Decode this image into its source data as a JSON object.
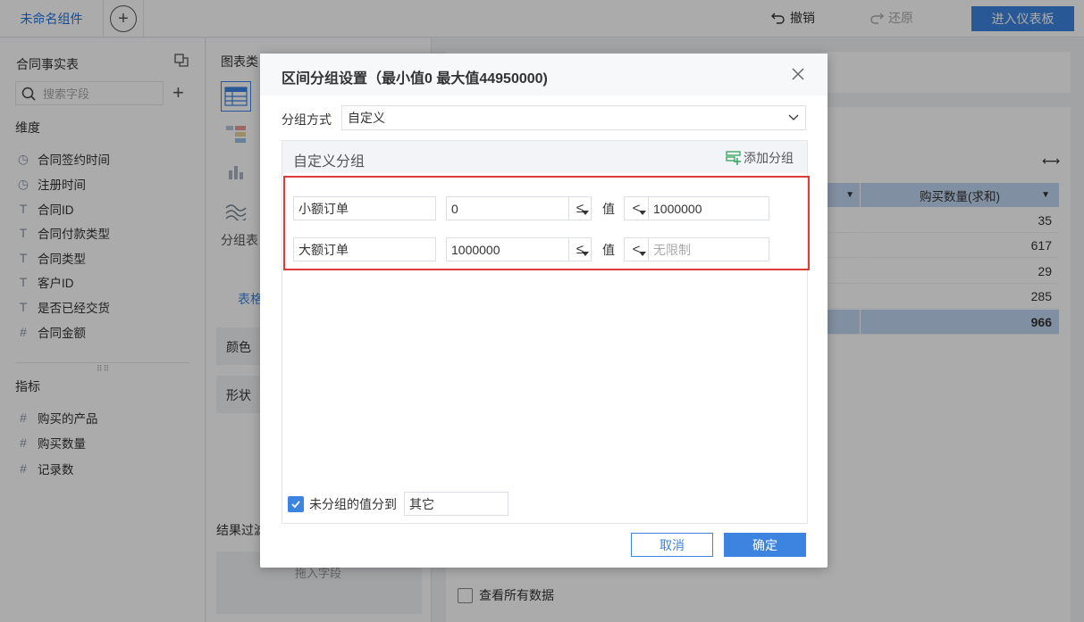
{
  "topbar": {
    "tab_name": "未命名组件",
    "undo_label": "撤销",
    "redo_label": "还原",
    "enter_dashboard_label": "进入仪表板"
  },
  "field_panel": {
    "dataset_title": "合同事实表",
    "search_placeholder": "搜索字段",
    "dimension_title": "维度",
    "dimensions": [
      {
        "icon": "clock-icon",
        "label": "合同签约时间"
      },
      {
        "icon": "clock-icon",
        "label": "注册时间"
      },
      {
        "icon": "text-type-icon",
        "label": "合同ID"
      },
      {
        "icon": "text-type-icon",
        "label": "合同付款类型"
      },
      {
        "icon": "text-type-icon",
        "label": "合同类型"
      },
      {
        "icon": "text-type-icon",
        "label": "客户ID"
      },
      {
        "icon": "text-type-icon",
        "label": "是否已经交货"
      },
      {
        "icon": "number-type-icon",
        "label": "合同金额"
      }
    ],
    "metric_title": "指标",
    "metrics": [
      {
        "icon": "number-type-icon",
        "label": "购买的产品"
      },
      {
        "icon": "number-type-icon",
        "label": "购买数量"
      },
      {
        "icon": "record-count-icon",
        "label": "记录数"
      }
    ]
  },
  "config_panel": {
    "chart_type_label": "图表类",
    "group_table_label": "分组表",
    "table_tab_label": "表格",
    "color_label": "颜色",
    "shape_label": "形状",
    "result_filter_label": "结果过滤",
    "drag_field_label": "拖入字段"
  },
  "preview": {
    "columns": [
      "",
      "购买数量(求和)"
    ],
    "rows": [
      "35",
      "617",
      "29",
      "285"
    ],
    "total": "966",
    "view_all_label": "查看所有数据"
  },
  "dialog": {
    "title": "区间分组设置（最小值0 最大值44950000)",
    "mode_label": "分组方式",
    "mode_value": "自定义",
    "custom_group_title": "自定义分组",
    "add_group_label": "添加分组",
    "value_label": "值",
    "groups": [
      {
        "name": "小额订单",
        "min": "0",
        "min_op": "≤",
        "max_op": "<",
        "max": "1000000",
        "max_placeholder": ""
      },
      {
        "name": "大额订单",
        "min": "1000000",
        "min_op": "≤",
        "max_op": "<",
        "max": "",
        "max_placeholder": "无限制"
      }
    ],
    "ungrouped_label": "未分组的值分到",
    "ungrouped_checked": true,
    "ungrouped_value": "其它",
    "cancel_label": "取消",
    "ok_label": "确定"
  },
  "colors": {
    "accent": "#3d84e0",
    "highlight_border": "#e23a3a",
    "header_blue": "#bfd5f2",
    "add_group_green": "#2fa35d"
  }
}
